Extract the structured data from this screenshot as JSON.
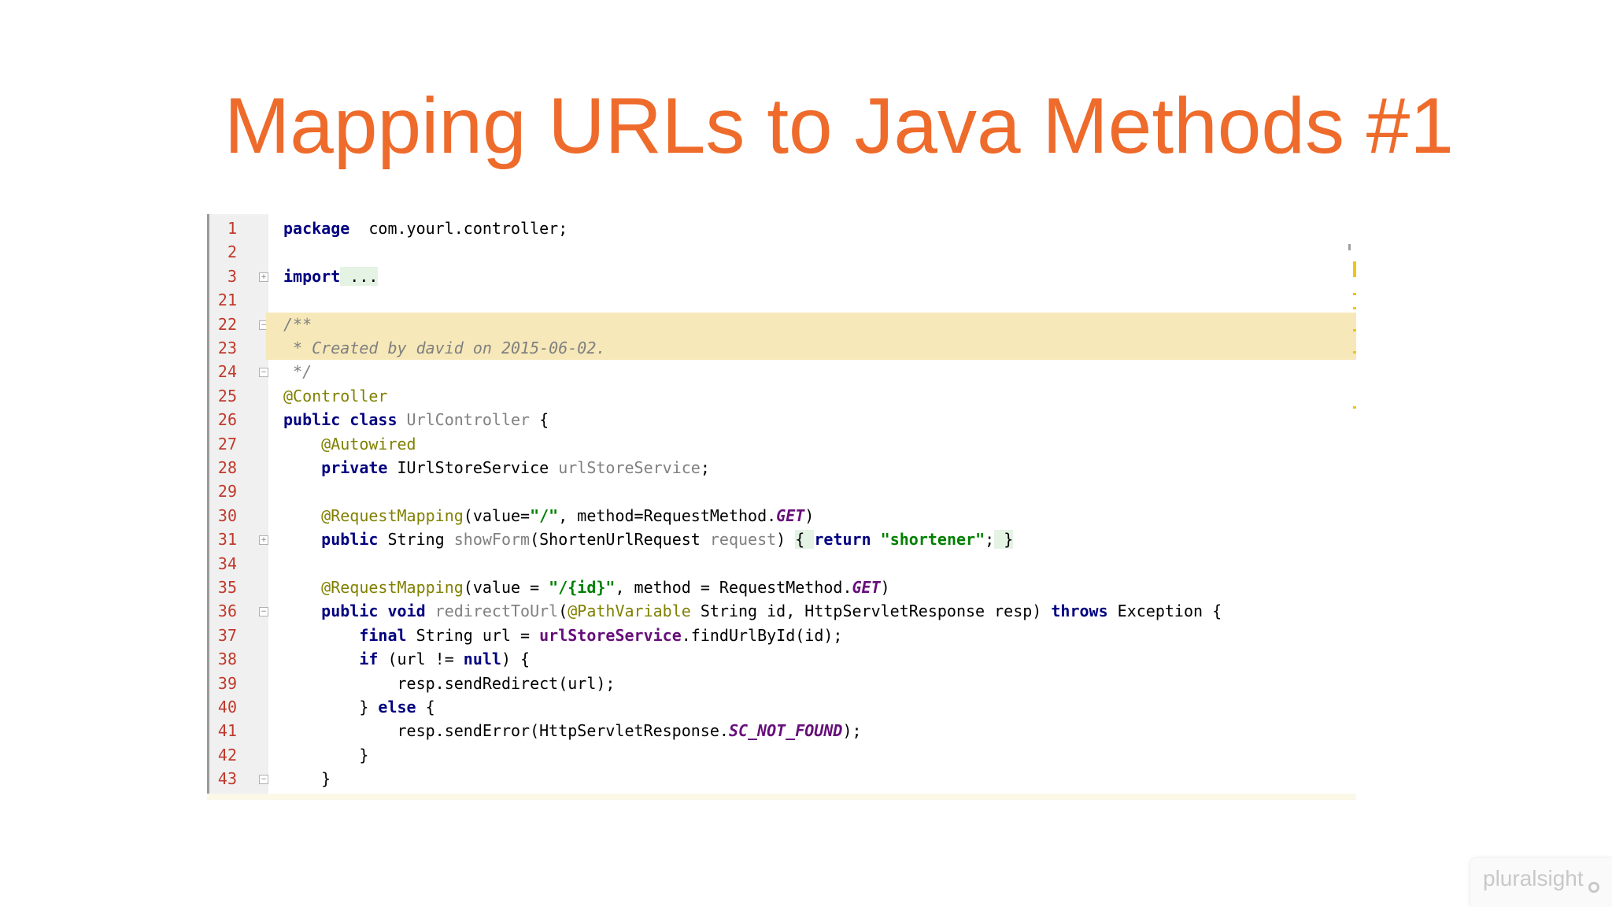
{
  "slide": {
    "title": "Mapping URLs to Java Methods #1"
  },
  "editor": {
    "lines": [
      {
        "n": "1",
        "segments": [
          [
            "kw",
            "package"
          ],
          [
            "",
            "  com.yourl.controller;"
          ]
        ]
      },
      {
        "n": "2",
        "segments": []
      },
      {
        "n": "3",
        "fold": "+",
        "segments": [
          [
            "kw",
            "import"
          ],
          [
            "",
            ""
          ],
          [
            "fold-box",
            " ..."
          ]
        ]
      },
      {
        "n": "21",
        "segments": []
      },
      {
        "n": "22",
        "fold": "-",
        "hl": true,
        "segments": [
          [
            "cmt",
            "/**"
          ]
        ]
      },
      {
        "n": "23",
        "hl": true,
        "segments": [
          [
            "cmt",
            " * Created by david on 2015-06-02."
          ]
        ]
      },
      {
        "n": "24",
        "fold": "-",
        "segments": [
          [
            "cmt",
            " */"
          ]
        ]
      },
      {
        "n": "25",
        "segments": [
          [
            "ann",
            "@Controller"
          ]
        ]
      },
      {
        "n": "26",
        "segments": [
          [
            "kw",
            "public class "
          ],
          [
            "unused",
            "UrlController"
          ],
          [
            "",
            " {"
          ]
        ]
      },
      {
        "n": "27",
        "segments": [
          [
            "",
            "    "
          ],
          [
            "ann",
            "@Autowired"
          ]
        ]
      },
      {
        "n": "28",
        "segments": [
          [
            "",
            "    "
          ],
          [
            "kw",
            "private "
          ],
          [
            "",
            "IUrlStoreService "
          ],
          [
            "unused",
            "urlStoreService"
          ],
          [
            "",
            ";"
          ]
        ]
      },
      {
        "n": "29",
        "segments": []
      },
      {
        "n": "30",
        "segments": [
          [
            "",
            "    "
          ],
          [
            "ann",
            "@RequestMapping"
          ],
          [
            "",
            "(value="
          ],
          [
            "str",
            "\"/\""
          ],
          [
            "",
            ", method=RequestMethod."
          ],
          [
            "cst",
            "GET"
          ],
          [
            "",
            ")"
          ]
        ]
      },
      {
        "n": "31",
        "fold": "+",
        "segments": [
          [
            "",
            "    "
          ],
          [
            "kw",
            "public "
          ],
          [
            "",
            "String "
          ],
          [
            "unused",
            "showForm"
          ],
          [
            "",
            "(ShortenUrlRequest "
          ],
          [
            "unused",
            "request"
          ],
          [
            "",
            ") "
          ],
          [
            "fold-box",
            "{ "
          ],
          [
            "kw",
            "return "
          ],
          [
            "str",
            "\"shortener\""
          ],
          [
            "",
            ";"
          ],
          [
            "fold-box",
            " }"
          ]
        ]
      },
      {
        "n": "34",
        "segments": []
      },
      {
        "n": "35",
        "segments": [
          [
            "",
            "    "
          ],
          [
            "ann",
            "@RequestMapping"
          ],
          [
            "",
            "(value = "
          ],
          [
            "str",
            "\"/{id}\""
          ],
          [
            "",
            ", method = RequestMethod."
          ],
          [
            "cst",
            "GET"
          ],
          [
            "",
            ")"
          ]
        ]
      },
      {
        "n": "36",
        "fold": "-",
        "segments": [
          [
            "",
            "    "
          ],
          [
            "kw",
            "public void "
          ],
          [
            "unused",
            "redirectToUrl"
          ],
          [
            "",
            "("
          ],
          [
            "ann",
            "@PathVariable "
          ],
          [
            "",
            "String id, HttpServletResponse resp) "
          ],
          [
            "kw",
            "throws "
          ],
          [
            "",
            "Exception {"
          ]
        ]
      },
      {
        "n": "37",
        "segments": [
          [
            "",
            "        "
          ],
          [
            "kw",
            "final "
          ],
          [
            "",
            "String url = "
          ],
          [
            "fld",
            "urlStoreService"
          ],
          [
            "",
            ".findUrlById(id);"
          ]
        ]
      },
      {
        "n": "38",
        "segments": [
          [
            "",
            "        "
          ],
          [
            "kw",
            "if "
          ],
          [
            "",
            "(url != "
          ],
          [
            "kw",
            "null"
          ],
          [
            "",
            ") {"
          ]
        ]
      },
      {
        "n": "39",
        "segments": [
          [
            "",
            "            resp.sendRedirect(url);"
          ]
        ]
      },
      {
        "n": "40",
        "segments": [
          [
            "",
            "        } "
          ],
          [
            "kw",
            "else "
          ],
          [
            "",
            "{"
          ]
        ]
      },
      {
        "n": "41",
        "segments": [
          [
            "",
            "            resp.sendError(HttpServletResponse."
          ],
          [
            "cst",
            "SC_NOT_FOUND"
          ],
          [
            "",
            ");"
          ]
        ]
      },
      {
        "n": "42",
        "segments": [
          [
            "",
            "        }"
          ]
        ]
      },
      {
        "n": "43",
        "fold": "-",
        "segments": [
          [
            "",
            "    }"
          ]
        ]
      }
    ]
  },
  "branding": {
    "logo_text": "pluralsight"
  },
  "colors": {
    "title": "#ee6b2b",
    "line_numbers": "#c0392b",
    "highlight": "#f6e8b8"
  }
}
